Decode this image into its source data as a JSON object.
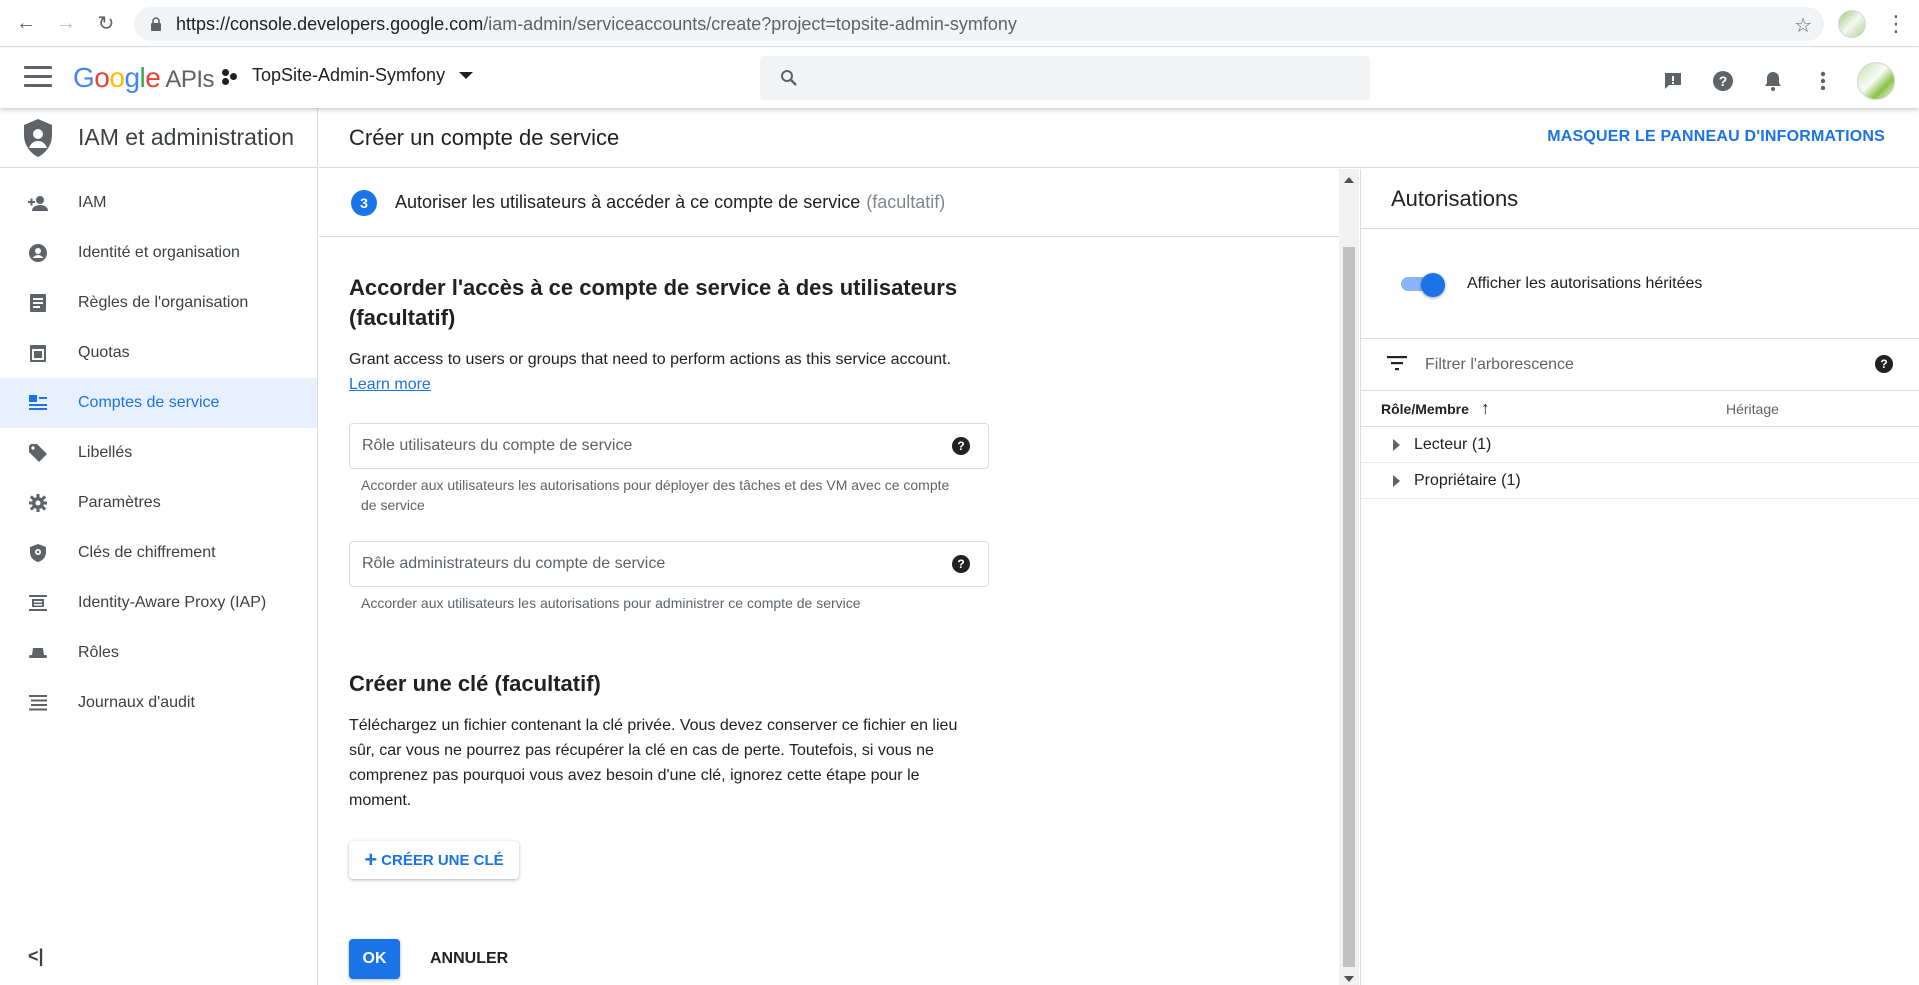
{
  "browser": {
    "url_host": "https://console.developers.google.com",
    "url_path": "/iam-admin/serviceaccounts/create?project=topsite-admin-symfony"
  },
  "header": {
    "logo_google": [
      "G",
      "o",
      "o",
      "g",
      "l",
      "e"
    ],
    "logo_apis": "APIs",
    "project_name": "TopSite-Admin-Symfony"
  },
  "sidebar": {
    "title": "IAM et administration",
    "items": [
      {
        "label": "IAM",
        "icon": "person-add-icon"
      },
      {
        "label": "Identité et organisation",
        "icon": "account-circle-icon"
      },
      {
        "label": "Règles de l'organisation",
        "icon": "document-icon"
      },
      {
        "label": "Quotas",
        "icon": "calendar-icon"
      },
      {
        "label": "Comptes de service",
        "icon": "service-account-icon",
        "active": true
      },
      {
        "label": "Libellés",
        "icon": "tag-icon"
      },
      {
        "label": "Paramètres",
        "icon": "gear-icon"
      },
      {
        "label": "Clés de chiffrement",
        "icon": "security-shield-icon"
      },
      {
        "label": "Identity-Aware Proxy (IAP)",
        "icon": "iap-icon"
      },
      {
        "label": "Rôles",
        "icon": "hat-icon"
      },
      {
        "label": "Journaux d'audit",
        "icon": "list-icon"
      }
    ],
    "collapse": "<|"
  },
  "page": {
    "title": "Créer un compte de service",
    "hide_panel": "MASQUER LE PANNEAU D'INFORMATIONS"
  },
  "step": {
    "number": "3",
    "text": "Autoriser les utilisateurs à accéder à ce compte de service",
    "optional": "(facultatif)"
  },
  "grant": {
    "title": "Accorder l'accès à ce compte de service à des utilisateurs (facultatif)",
    "desc": "Grant access to users or groups that need to perform actions as this service account.",
    "learn_more": "Learn more",
    "field1_placeholder": "Rôle utilisateurs du compte de service",
    "field1_hint": "Accorder aux utilisateurs les autorisations pour déployer des tâches et des VM avec ce compte de service",
    "field2_placeholder": "Rôle administrateurs du compte de service",
    "field2_hint": "Accorder aux utilisateurs les autorisations pour administrer ce compte de service"
  },
  "key": {
    "title": "Créer une clé (facultatif)",
    "desc": "Téléchargez un fichier contenant la clé privée. Vous devez conserver ce fichier en lieu sûr, car vous ne pourrez pas récupérer la clé en cas de perte. Toutefois, si vous ne comprenez pas pourquoi vous avez besoin d'une clé, ignorez cette étape pour le moment.",
    "button": "CRÉER UNE CLÉ"
  },
  "actions": {
    "ok": "OK",
    "cancel": "ANNULER"
  },
  "panel": {
    "title": "Autorisations",
    "toggle_label": "Afficher les autorisations héritées",
    "toggle_on": true,
    "filter_placeholder": "Filtrer l'arborescence",
    "col_role": "Rôle/Membre",
    "col_inheritance": "Héritage",
    "rows": [
      "Lecteur (1)",
      "Propriétaire (1)"
    ]
  },
  "colors": {
    "accent": "#1a73e8",
    "active_bg": "#e8f0fe"
  }
}
